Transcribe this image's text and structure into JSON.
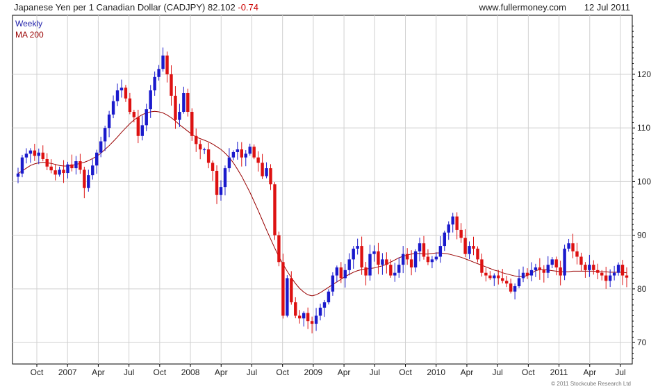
{
  "header": {
    "title": "Japanese Yen per 1 Canadian Dollar (CADJPY)",
    "last_price": "82.102",
    "change": "-0.74",
    "website": "www.fullermoney.com",
    "date": "12 Jul 2011"
  },
  "legend": {
    "series_1": "Weekly",
    "series_2": "MA 200"
  },
  "copyright": "© 2011 Stockcube Research Ltd",
  "colors": {
    "up_candle": "#1a1acc",
    "down_candle": "#dd1111",
    "moving_average": "#990000",
    "grid": "#d0d0d0",
    "frame": "#000000"
  },
  "chart_data": {
    "type": "candlestick",
    "title": "Japanese Yen per 1 Canadian Dollar (CADJPY)",
    "frequency": "Weekly",
    "overlay": "MA 200",
    "y_axis_side": "right",
    "ylim": [
      66,
      131
    ],
    "y_ticks": [
      70,
      80,
      90,
      100,
      110,
      120
    ],
    "x_ticks": [
      "Oct",
      "2007",
      "Apr",
      "Jul",
      "Oct",
      "2008",
      "Apr",
      "Jul",
      "Oct",
      "2009",
      "Apr",
      "Jul",
      "Oct",
      "2010",
      "Apr",
      "Jul",
      "Oct",
      "2011",
      "Apr",
      "Jul"
    ],
    "grid": true,
    "approx_weekly_closes": [
      101.5,
      104.5,
      105.2,
      105.8,
      104.8,
      105.4,
      104.2,
      102.8,
      102.1,
      101.3,
      102.2,
      101.6,
      103.2,
      102.5,
      103.8,
      102.2,
      98.8,
      101.2,
      103.0,
      105.4,
      107.5,
      110.0,
      112.5,
      115.0,
      117.0,
      117.5,
      115.5,
      113.0,
      112.0,
      108.5,
      110.5,
      113.5,
      117.0,
      119.5,
      121.0,
      123.5,
      120.0,
      116.0,
      111.5,
      113.0,
      116.5,
      113.0,
      108.5,
      107.0,
      106.0,
      106.0,
      103.5,
      102.0,
      97.5,
      99.0,
      102.5,
      104.5,
      105.5,
      106.0,
      104.5,
      105.2,
      106.5,
      104.5,
      103.5,
      101.0,
      102.5,
      99.5,
      90.0,
      85.0,
      75.0,
      82.0,
      77.5,
      75.0,
      74.5,
      75.5,
      74.0,
      73.5,
      75.0,
      76.5,
      77.5,
      79.5,
      82.5,
      84.0,
      82.0,
      83.5,
      85.5,
      87.5,
      88.0,
      84.0,
      82.5,
      86.5,
      87.0,
      84.5,
      85.5,
      84.5,
      82.5,
      83.0,
      84.5,
      86.5,
      85.5,
      84.0,
      87.0,
      88.5,
      86.0,
      85.0,
      85.5,
      86.0,
      88.0,
      90.5,
      92.0,
      93.5,
      91.0,
      89.5,
      86.5,
      88.0,
      87.5,
      85.5,
      83.0,
      82.5,
      82.0,
      82.5,
      82.0,
      81.5,
      81.0,
      79.5,
      80.5,
      82.0,
      83.0,
      82.5,
      83.5,
      84.0,
      83.5,
      83.0,
      84.5,
      85.5,
      84.0,
      82.5,
      87.5,
      88.5,
      87.0,
      86.0,
      84.5,
      83.5,
      84.5,
      83.5,
      83.0,
      82.5,
      81.5,
      82.5,
      83.0,
      84.5,
      82.5,
      82.1
    ],
    "approx_ma200": [
      101.5,
      102.0,
      102.5,
      103.0,
      103.3,
      103.5,
      103.6,
      103.5,
      103.4,
      103.2,
      103.0,
      102.9,
      102.9,
      103.0,
      103.2,
      103.4,
      103.6,
      103.9,
      104.3,
      104.7,
      105.3,
      106.0,
      106.7,
      107.5,
      108.3,
      109.2,
      110.0,
      110.8,
      111.5,
      112.0,
      112.5,
      112.8,
      113.0,
      113.1,
      113.0,
      112.8,
      112.4,
      111.9,
      111.3,
      110.6,
      110.0,
      109.4,
      108.8,
      108.3,
      108.0,
      107.7,
      107.4,
      107.0,
      106.5,
      106.0,
      105.3,
      104.5,
      103.5,
      102.3,
      101.0,
      99.5,
      98.0,
      96.3,
      94.6,
      92.8,
      91.0,
      89.3,
      87.6,
      86.0,
      84.6,
      83.3,
      82.1,
      81.0,
      80.1,
      79.4,
      78.9,
      78.7,
      78.9,
      79.3,
      79.8,
      80.3,
      80.8,
      81.3,
      81.8,
      82.3,
      82.7,
      83.1,
      83.4,
      83.6,
      83.7,
      83.8,
      83.9,
      84.1,
      84.3,
      84.6,
      85.0,
      85.4,
      85.8,
      86.1,
      86.3,
      86.5,
      86.6,
      86.6,
      86.5,
      86.5,
      86.6,
      86.7,
      86.7,
      86.6,
      86.5,
      86.3,
      86.1,
      85.9,
      85.6,
      85.3,
      85.0,
      84.7,
      84.4,
      84.1,
      83.8,
      83.5,
      83.3,
      83.0,
      82.8,
      82.6,
      82.4,
      82.3,
      82.3,
      82.5,
      82.9,
      83.4,
      83.6,
      83.6,
      83.5,
      83.4,
      83.3,
      83.2,
      83.2,
      83.2,
      83.3,
      83.3,
      83.3,
      83.3,
      83.3,
      83.3,
      83.2,
      83.2,
      83.2,
      83.1,
      83.1,
      83.1,
      83.1,
      83.0
    ]
  }
}
